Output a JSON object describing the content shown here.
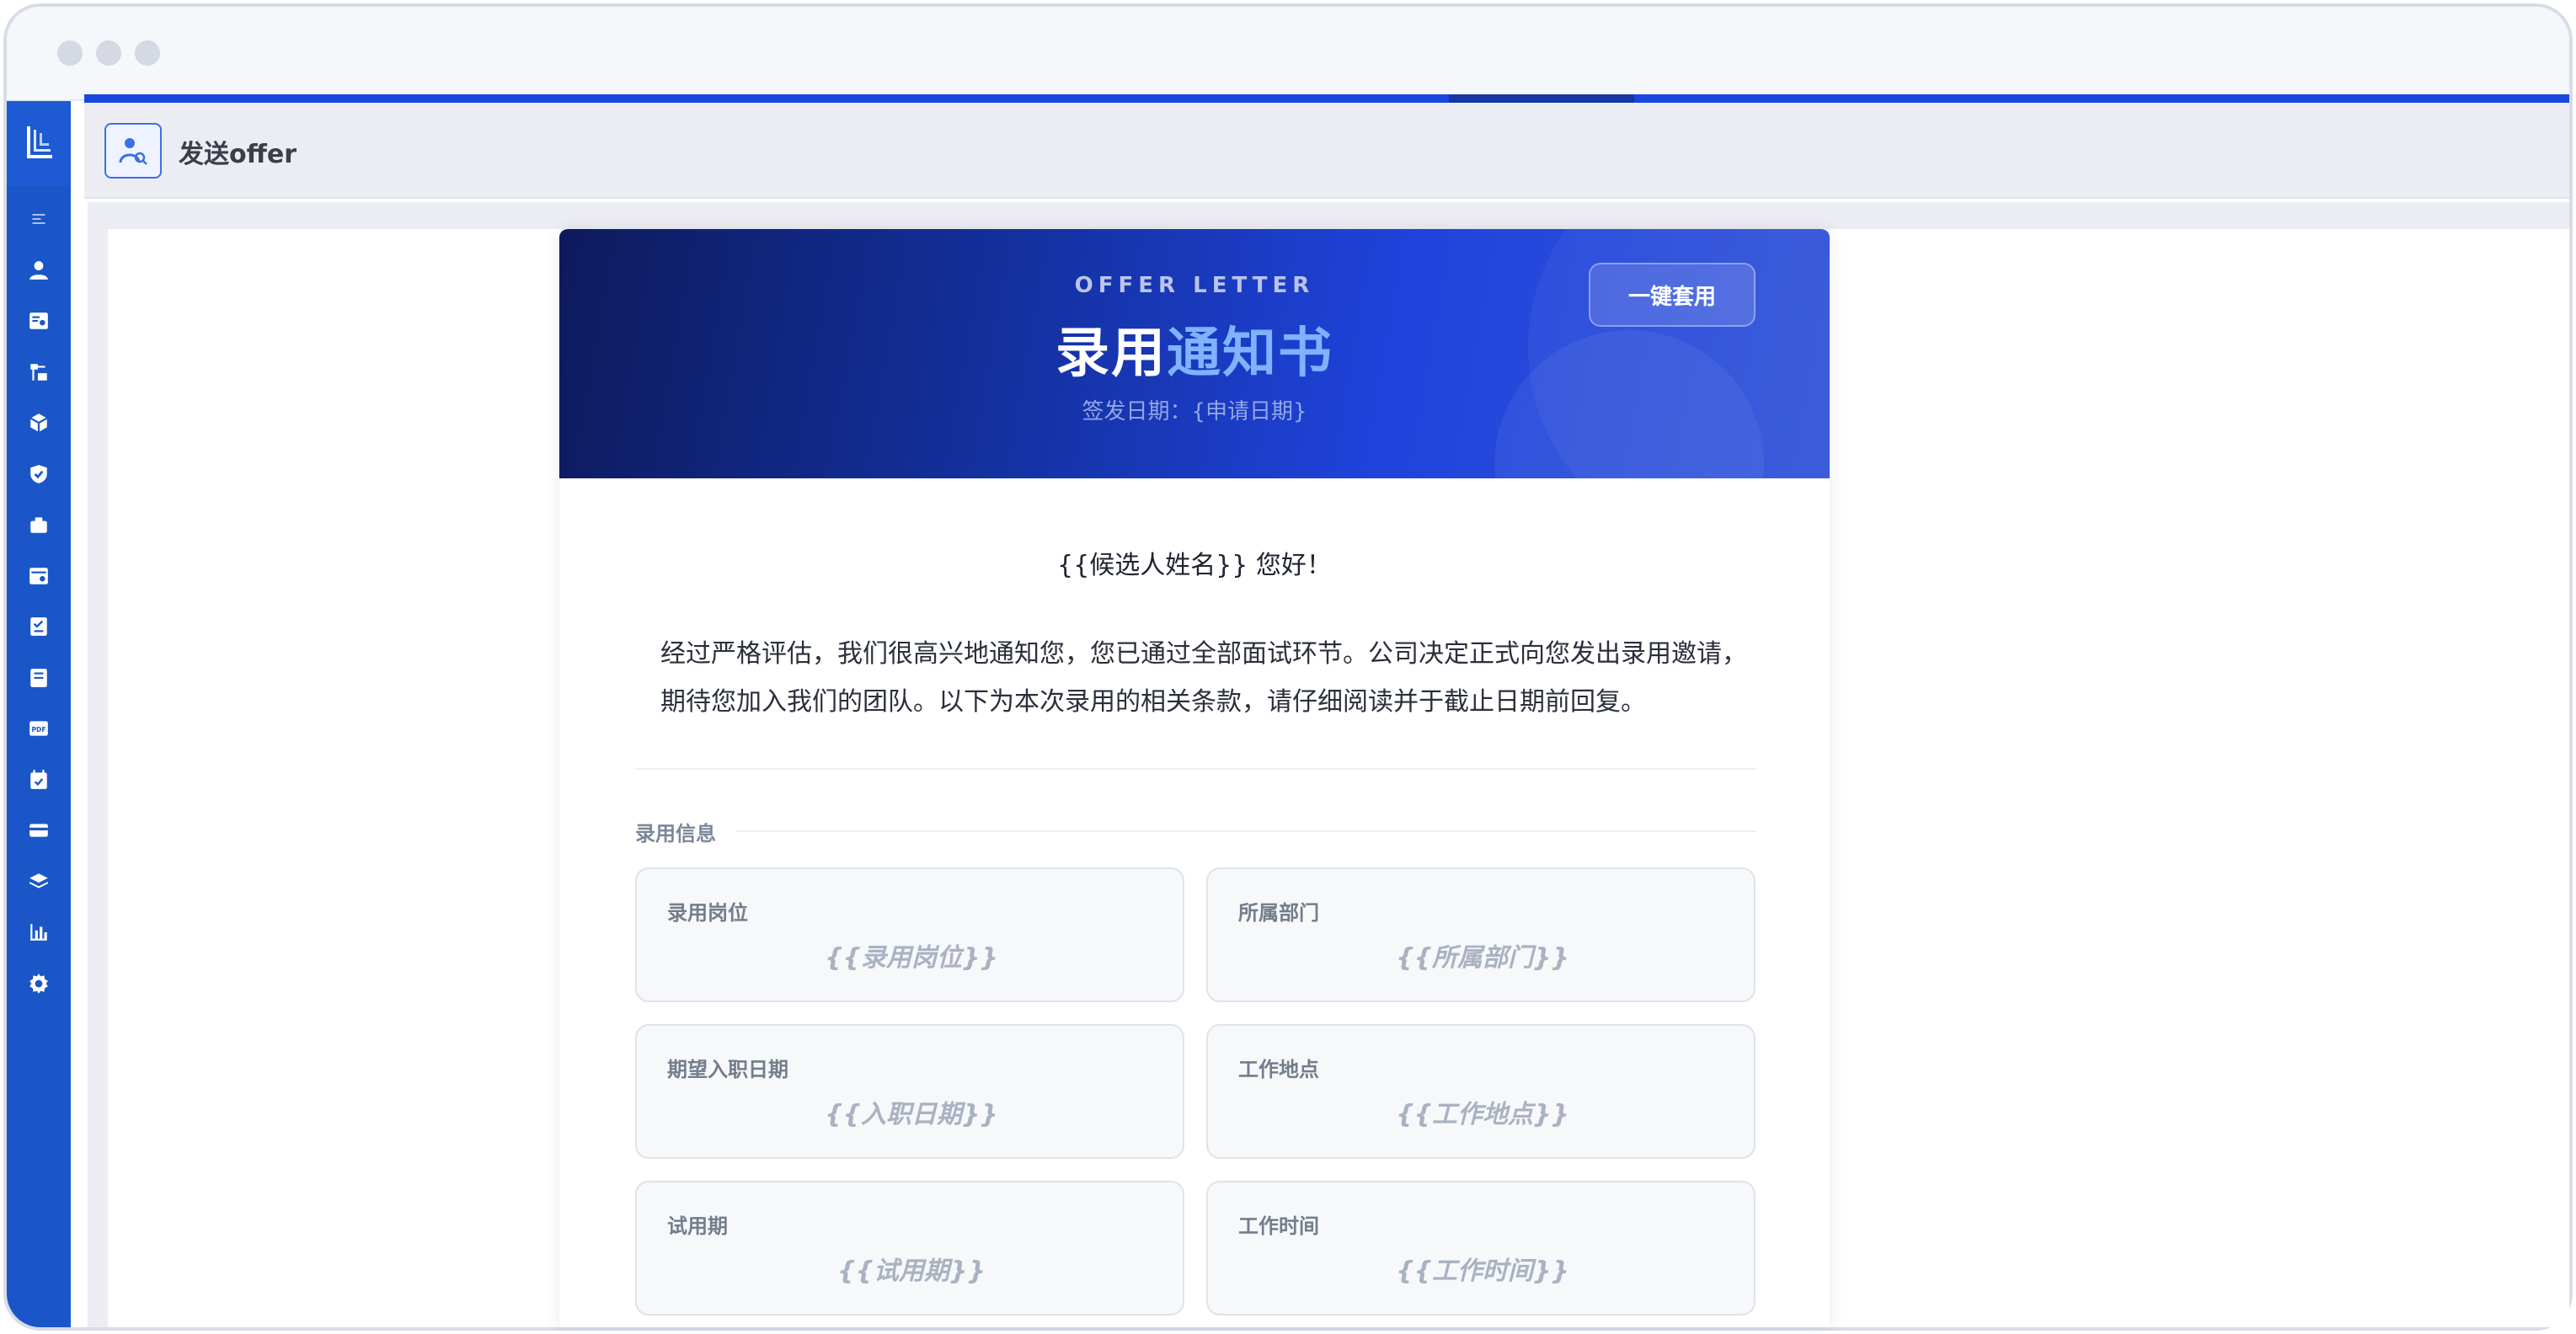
{
  "header": {
    "title": "发送offer"
  },
  "sidebar": {
    "items": [
      {
        "icon": "collapse-icon"
      },
      {
        "icon": "user-icon"
      },
      {
        "icon": "resume-search-icon"
      },
      {
        "icon": "org-chart-icon"
      },
      {
        "icon": "cube-icon"
      },
      {
        "icon": "shield-check-icon"
      },
      {
        "icon": "briefcase-icon"
      },
      {
        "icon": "settings-panel-icon"
      },
      {
        "icon": "checklist-icon"
      },
      {
        "icon": "book-icon"
      },
      {
        "icon": "pdf-icon"
      },
      {
        "icon": "calendar-check-icon"
      },
      {
        "icon": "card-icon"
      },
      {
        "icon": "layers-icon"
      },
      {
        "icon": "bar-chart-icon"
      },
      {
        "icon": "gear-icon"
      }
    ]
  },
  "letter": {
    "eyebrow": "OFFER LETTER",
    "title_main": "录用",
    "title_accent": "通知书",
    "issue_date": "签发日期：{申请日期}",
    "apply_button": "一键套用",
    "greeting": "{{候选人姓名}} 您好！",
    "intro": "经过严格评估，我们很高兴地通知您，您已通过全部面试环节。公司决定正式向您发出录用邀请，期待您加入我们的团队。以下为本次录用的相关条款，请仔细阅读并于截止日期前回复。",
    "section_title": "录用信息",
    "fields": [
      {
        "label": "录用岗位",
        "value": "{{录用岗位}}"
      },
      {
        "label": "所属部门",
        "value": "{{所属部门}}"
      },
      {
        "label": "期望入职日期",
        "value": "{{入职日期}}"
      },
      {
        "label": "工作地点",
        "value": "{{工作地点}}"
      },
      {
        "label": "试用期",
        "value": "{{试用期}}"
      },
      {
        "label": "工作时间",
        "value": "{{工作时间}}"
      }
    ]
  },
  "colors": {
    "sidebar": "#1a56c7",
    "progress": "#1746e0",
    "banner_start": "#0e1a5c",
    "banner_end": "#3356da",
    "title_accent": "#7fb2ff"
  }
}
